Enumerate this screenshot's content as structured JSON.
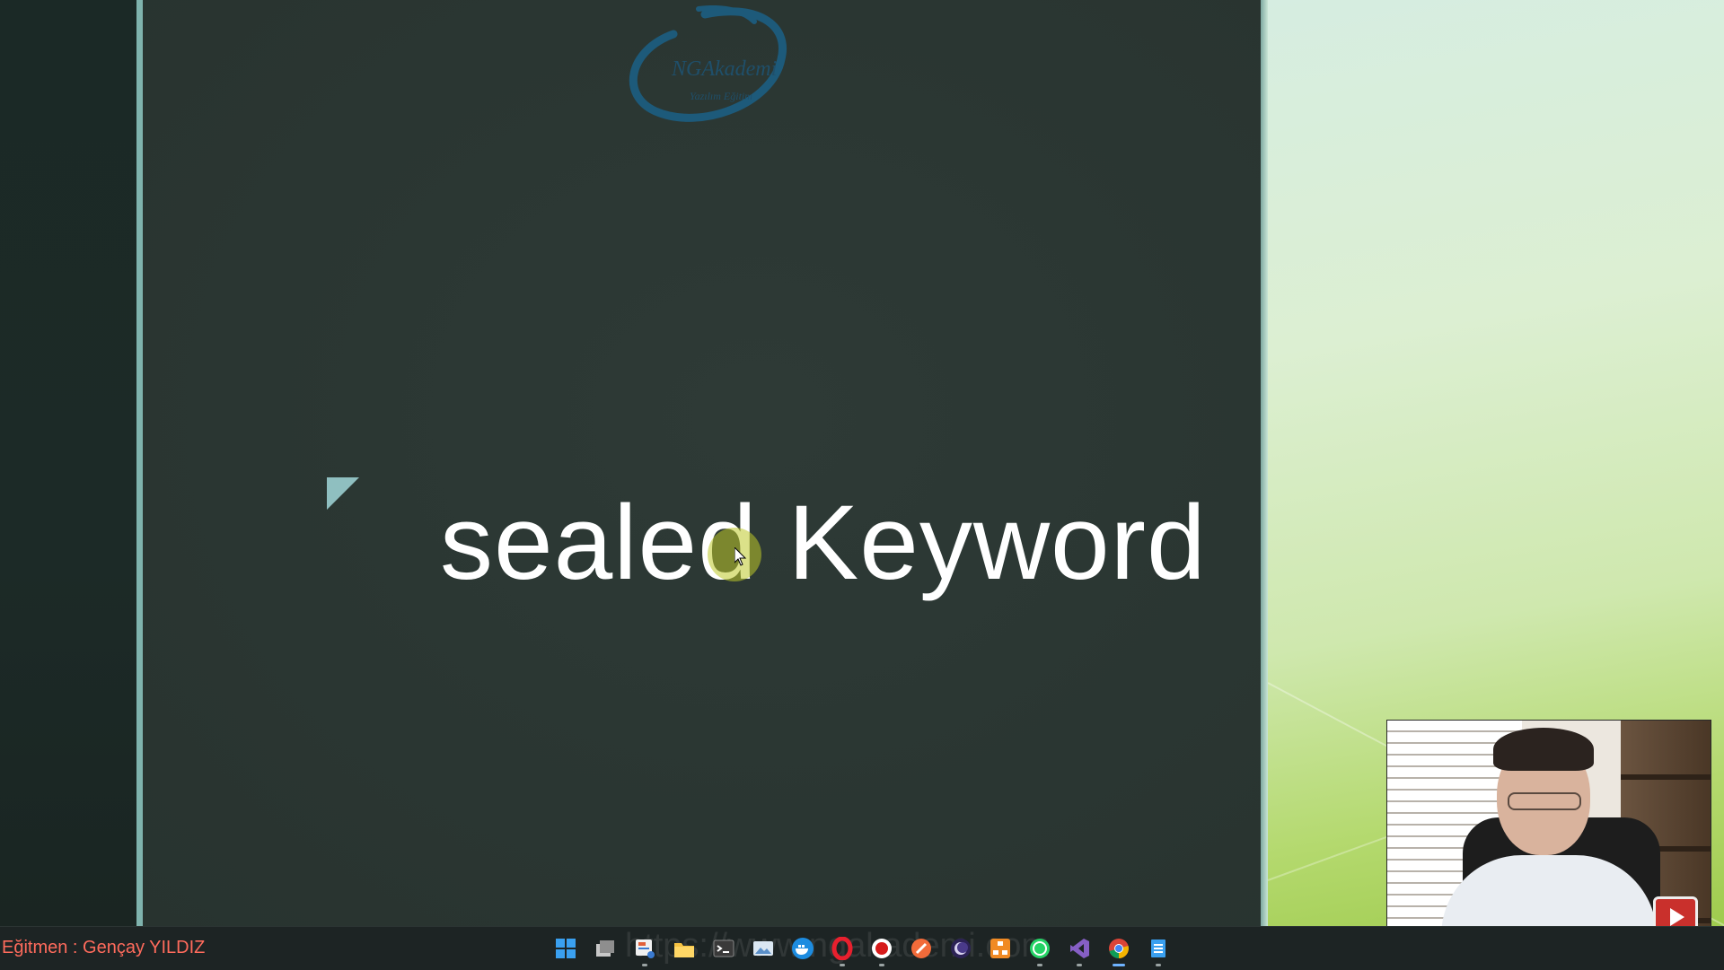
{
  "slide": {
    "title": "sealed Keyword",
    "logo_text": "NGAkademi",
    "logo_subtext": "Yazılım Eğitim"
  },
  "footer": {
    "instructor": "Eğitmen : Gençay YILDIZ",
    "watermark": "https://www.ngakademi.com"
  },
  "taskbar": {
    "icons": [
      "windows-start-icon",
      "task-view-icon",
      "snipping-tool-icon",
      "file-explorer-icon",
      "terminal-icon",
      "photos-icon",
      "docker-icon",
      "opera-icon",
      "record-icon",
      "postman-icon",
      "eclipse-icon",
      "network-app-icon",
      "whatsapp-icon",
      "visual-studio-icon",
      "chrome-icon",
      "notepad-icon"
    ]
  },
  "colors": {
    "slide_bg": "#2b3733",
    "title": "#ffffff",
    "instructor_text": "#ff6b5c",
    "accent_border": "#7fb3ad",
    "logo": "#1f4f6a"
  }
}
